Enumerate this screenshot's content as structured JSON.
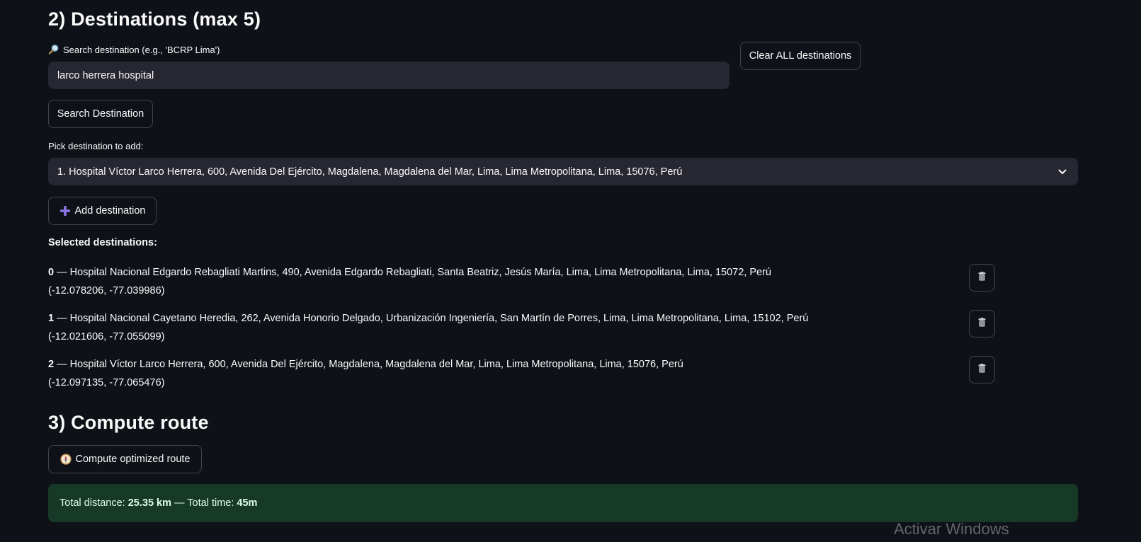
{
  "destinations_section": {
    "title": "2) Destinations (max 5)",
    "search_icon": "magnifier-icon",
    "search_label": "Search destination (e.g., 'BCRP Lima')",
    "search_value": "larco herrera hospital",
    "clear_all_label": "Clear ALL destinations",
    "search_button_label": "Search Destination",
    "pick_label": "Pick destination to add:",
    "pick_selected": "1. Hospital Víctor Larco Herrera, 600, Avenida Del Ejército, Magdalena, Magdalena del Mar, Lima, Lima Metropolitana, Lima, 15076, Perú",
    "add_icon": "plus-icon",
    "add_button_label": "Add destination",
    "selected_heading": "Selected destinations:",
    "selected": [
      {
        "index": "0",
        "separator": " — ",
        "address": "Hospital Nacional Edgardo Rebagliati Martins, 490, Avenida Edgardo Rebagliati, Santa Beatriz, Jesús María, Lima, Lima Metropolitana, Lima, 15072, Perú",
        "coords": "(-12.078206, -77.039986)"
      },
      {
        "index": "1",
        "separator": " — ",
        "address": "Hospital Nacional Cayetano Heredia, 262, Avenida Honorio Delgado, Urbanización Ingeniería, San Martín de Porres, Lima, Lima Metropolitana, Lima, 15102, Perú",
        "coords": "(-12.021606, -77.055099)"
      },
      {
        "index": "2",
        "separator": " — ",
        "address": "Hospital Víctor Larco Herrera, 600, Avenida Del Ejército, Magdalena, Magdalena del Mar, Lima, Lima Metropolitana, Lima, 15076, Perú",
        "coords": "(-12.097135, -77.065476)"
      }
    ]
  },
  "route_section": {
    "title": "3) Compute route",
    "compute_icon": "compass-icon",
    "compute_button_label": "Compute optimized route",
    "result_prefix": "Total distance: ",
    "distance": "25.35 km",
    "result_middle": " — Total time: ",
    "time": "45m"
  },
  "watermark": "Activar Windows",
  "colors": {
    "background": "#0e1117",
    "input_bg": "#262730",
    "success_bg": "#173928",
    "accent_purple": "#8b78e6"
  }
}
